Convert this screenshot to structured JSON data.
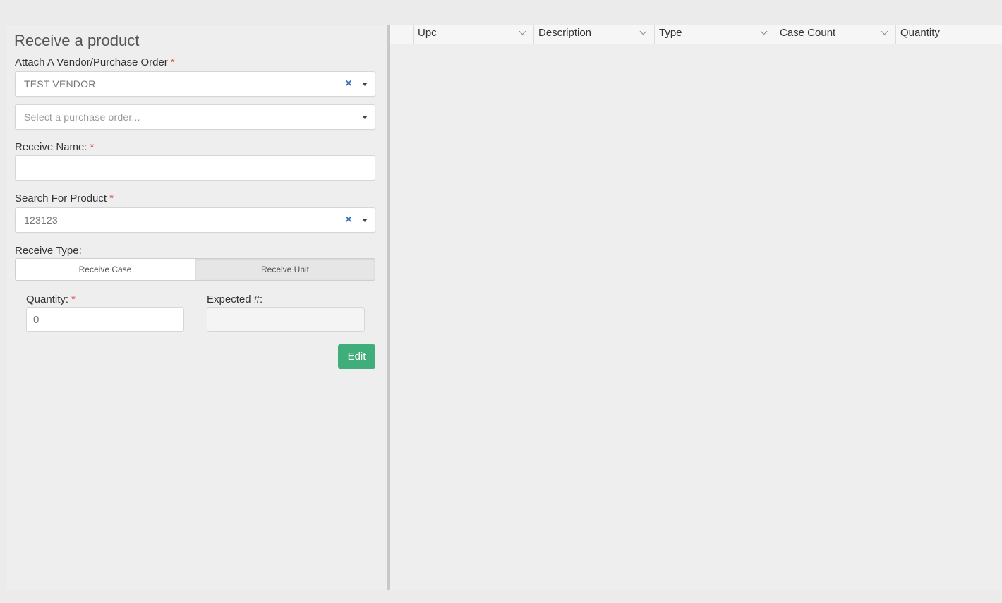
{
  "panel": {
    "title": "Receive a product",
    "vendor_label": "Attach A Vendor/Purchase Order",
    "required_mark": "*",
    "vendor_value": "TEST VENDOR",
    "purchase_order_placeholder": "Select a purchase order...",
    "receive_name_label": "Receive Name:",
    "receive_name_value": "",
    "search_product_label": "Search For Product",
    "search_product_value": "123123",
    "receive_type_label": "Receive Type:",
    "receive_case_label": "Receive Case",
    "receive_unit_label": "Receive Unit",
    "quantity_label": "Quantity:",
    "quantity_value": "0",
    "expected_label": "Expected #:",
    "expected_value": "",
    "edit_label": "Edit"
  },
  "grid": {
    "columns": [
      "Upc",
      "Description",
      "Type",
      "Case Count",
      "Quantity"
    ]
  },
  "icons": {
    "clear": "×",
    "caret": "caret-down-icon",
    "chevron": "chevron-down-icon"
  },
  "colors": {
    "accent_green": "#3fae7a",
    "clear_blue": "#3b6fb6",
    "required_red": "#e05555"
  }
}
